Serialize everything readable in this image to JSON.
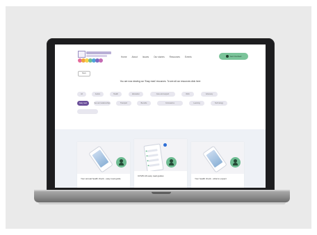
{
  "header": {
    "nav_items": [
      "Home",
      "About",
      "Issues",
      "Our stories",
      "Resources",
      "Events"
    ],
    "cta_label": "Get involved"
  },
  "page": {
    "back_label": "Back",
    "notice": "You are now viewing our 'Easy read' resources. To see all our resources click here"
  },
  "filters": {
    "chips": [
      "All",
      "Autism",
      "Health",
      "Education",
      "Care and support",
      "Work",
      "Advocacy",
      "Easy read",
      "Sex and relationships",
      "Transport",
      "Benefits",
      "Coronavirus",
      "Learning",
      "Technology"
    ],
    "active": "Easy read"
  },
  "cards": [
    {
      "title": "Your annual health check - easy read guide"
    },
    {
      "title": "COVID-19 easy read guides"
    },
    {
      "title": "Your health check - what to expect"
    }
  ],
  "colors": {
    "accent_purple": "#6b4f9a",
    "accent_green": "#7bc49a",
    "band": "#eef1f6"
  }
}
